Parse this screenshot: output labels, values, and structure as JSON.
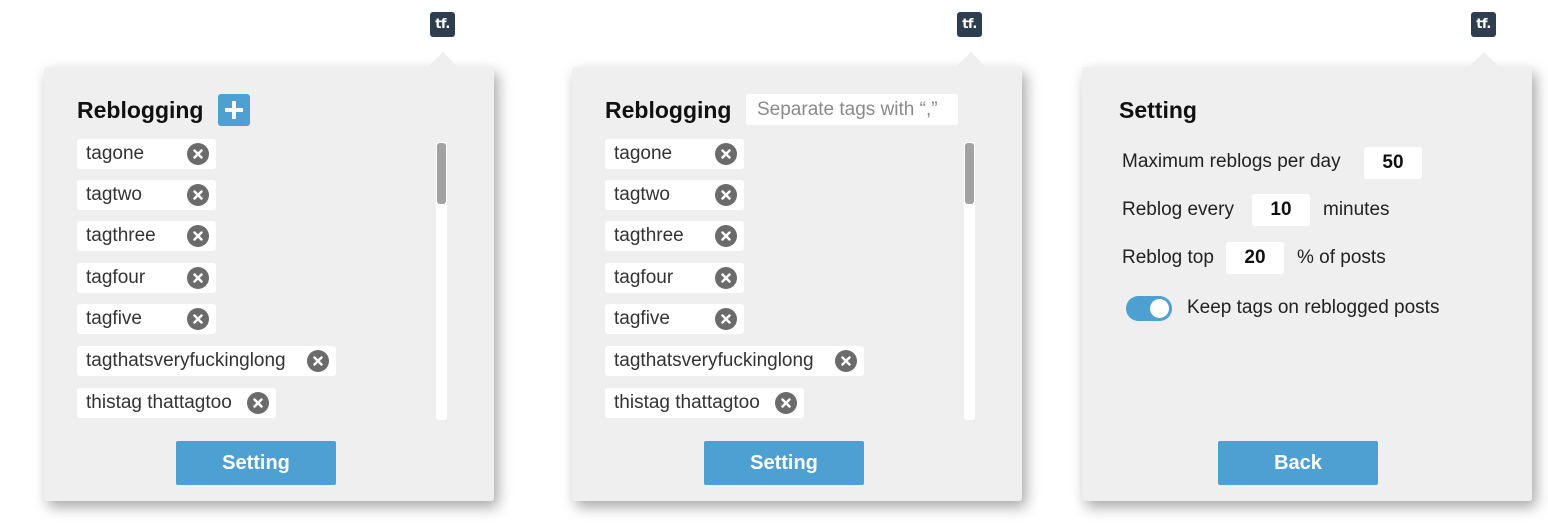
{
  "brand_icon": "tf.",
  "panels": [
    {
      "title": "Reblogging",
      "add_icon": "plus-icon",
      "tags": [
        {
          "label": "tagone"
        },
        {
          "label": "tagtwo"
        },
        {
          "label": "tagthree"
        },
        {
          "label": "tagfour"
        },
        {
          "label": "tagfive"
        },
        {
          "label": "tagthatsveryfuckinglong"
        },
        {
          "label": "thistag thattagtoo"
        }
      ],
      "button_label": "Setting"
    },
    {
      "title": "Reblogging",
      "input_placeholder": "Separate tags with “,”",
      "tags": [
        {
          "label": "tagone"
        },
        {
          "label": "tagtwo"
        },
        {
          "label": "tagthree"
        },
        {
          "label": "tagfour"
        },
        {
          "label": "tagfive"
        },
        {
          "label": "tagthatsveryfuckinglong"
        },
        {
          "label": "thistag thattagtoo"
        }
      ],
      "button_label": "Setting"
    },
    {
      "title": "Setting",
      "max_reblogs_label": "Maximum reblogs per day",
      "max_reblogs_value": "50",
      "reblog_every_label": "Reblog every",
      "reblog_every_value": "10",
      "reblog_every_unit": "minutes",
      "reblog_top_label": "Reblog top",
      "reblog_top_value": "20",
      "reblog_top_unit": "% of posts",
      "keep_tags_label": "Keep tags on reblogged posts",
      "keep_tags_enabled": true,
      "button_label": "Back"
    }
  ],
  "colors": {
    "accent": "#4e9fd2",
    "panel_bg": "#efefef",
    "brand_bg": "#2e3e4f",
    "remove_icon": "#6b6b6b"
  }
}
